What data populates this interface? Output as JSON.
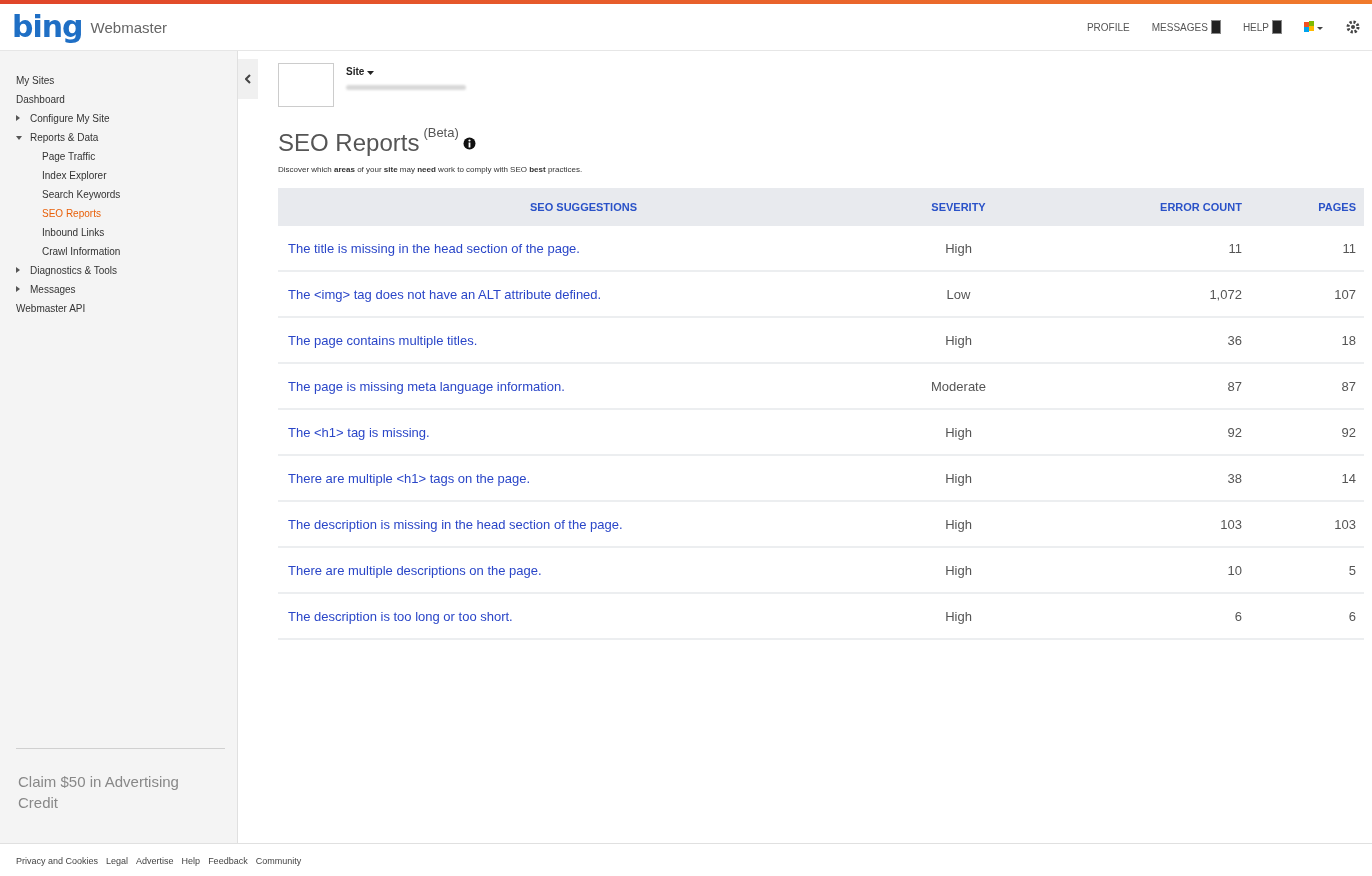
{
  "header": {
    "logo": "bing",
    "product": "Webmaster",
    "nav": [
      {
        "label": "PROFILE",
        "kind": "link"
      },
      {
        "label": "MESSAGES",
        "kind": "badge"
      },
      {
        "label": "HELP",
        "kind": "badge"
      }
    ]
  },
  "sidebar": {
    "items": [
      {
        "label": "My Sites",
        "selected": false
      },
      {
        "label": "Dashboard",
        "selected": false
      },
      {
        "label": "Configure My Site",
        "selected": false,
        "expanded": false
      },
      {
        "label": "Reports & Data",
        "selected": false,
        "expanded": true,
        "children": [
          {
            "label": "Page Traffic",
            "selected": false
          },
          {
            "label": "Index Explorer",
            "selected": false
          },
          {
            "label": "Search Keywords",
            "selected": false
          },
          {
            "label": "SEO Reports",
            "selected": true
          },
          {
            "label": "Inbound Links",
            "selected": false
          },
          {
            "label": "Crawl Information",
            "selected": false
          }
        ]
      },
      {
        "label": "Diagnostics & Tools",
        "selected": false,
        "expanded": false
      },
      {
        "label": "Messages",
        "selected": false,
        "expanded": false
      },
      {
        "label": "Webmaster API",
        "selected": false
      }
    ],
    "promo": "Claim $50 in Advertising Credit"
  },
  "site": {
    "label": "Site"
  },
  "page": {
    "title": "SEO Reports",
    "badge": "(Beta)",
    "description": "Discover which **areas** of your **site** may **need** work to comply with SEO **best** practices."
  },
  "table": {
    "columns": [
      "SEO SUGGESTIONS",
      "SEVERITY",
      "ERROR COUNT",
      "PAGES"
    ],
    "rows": [
      [
        "The title is missing in the head section of the page.",
        "High",
        "11",
        "11"
      ],
      [
        "The <img> tag does not have an ALT attribute defined.",
        "Low",
        "1,072",
        "107"
      ],
      [
        "The page contains multiple titles.",
        "High",
        "36",
        "18"
      ],
      [
        "The page is missing meta language information.",
        "Moderate",
        "87",
        "87"
      ],
      [
        "The <h1> tag is missing.",
        "High",
        "92",
        "92"
      ],
      [
        "There are multiple <h1> tags on the page.",
        "High",
        "38",
        "14"
      ],
      [
        "The description is missing in the head section of the page.",
        "High",
        "103",
        "103"
      ],
      [
        "There are multiple descriptions on the page.",
        "High",
        "10",
        "5"
      ],
      [
        "The description is too long or too short.",
        "High",
        "6",
        "6"
      ]
    ]
  },
  "footer": {
    "links": [
      "Privacy and Cookies",
      "Legal",
      "Advertise",
      "Help",
      "Feedback",
      "Community"
    ]
  }
}
